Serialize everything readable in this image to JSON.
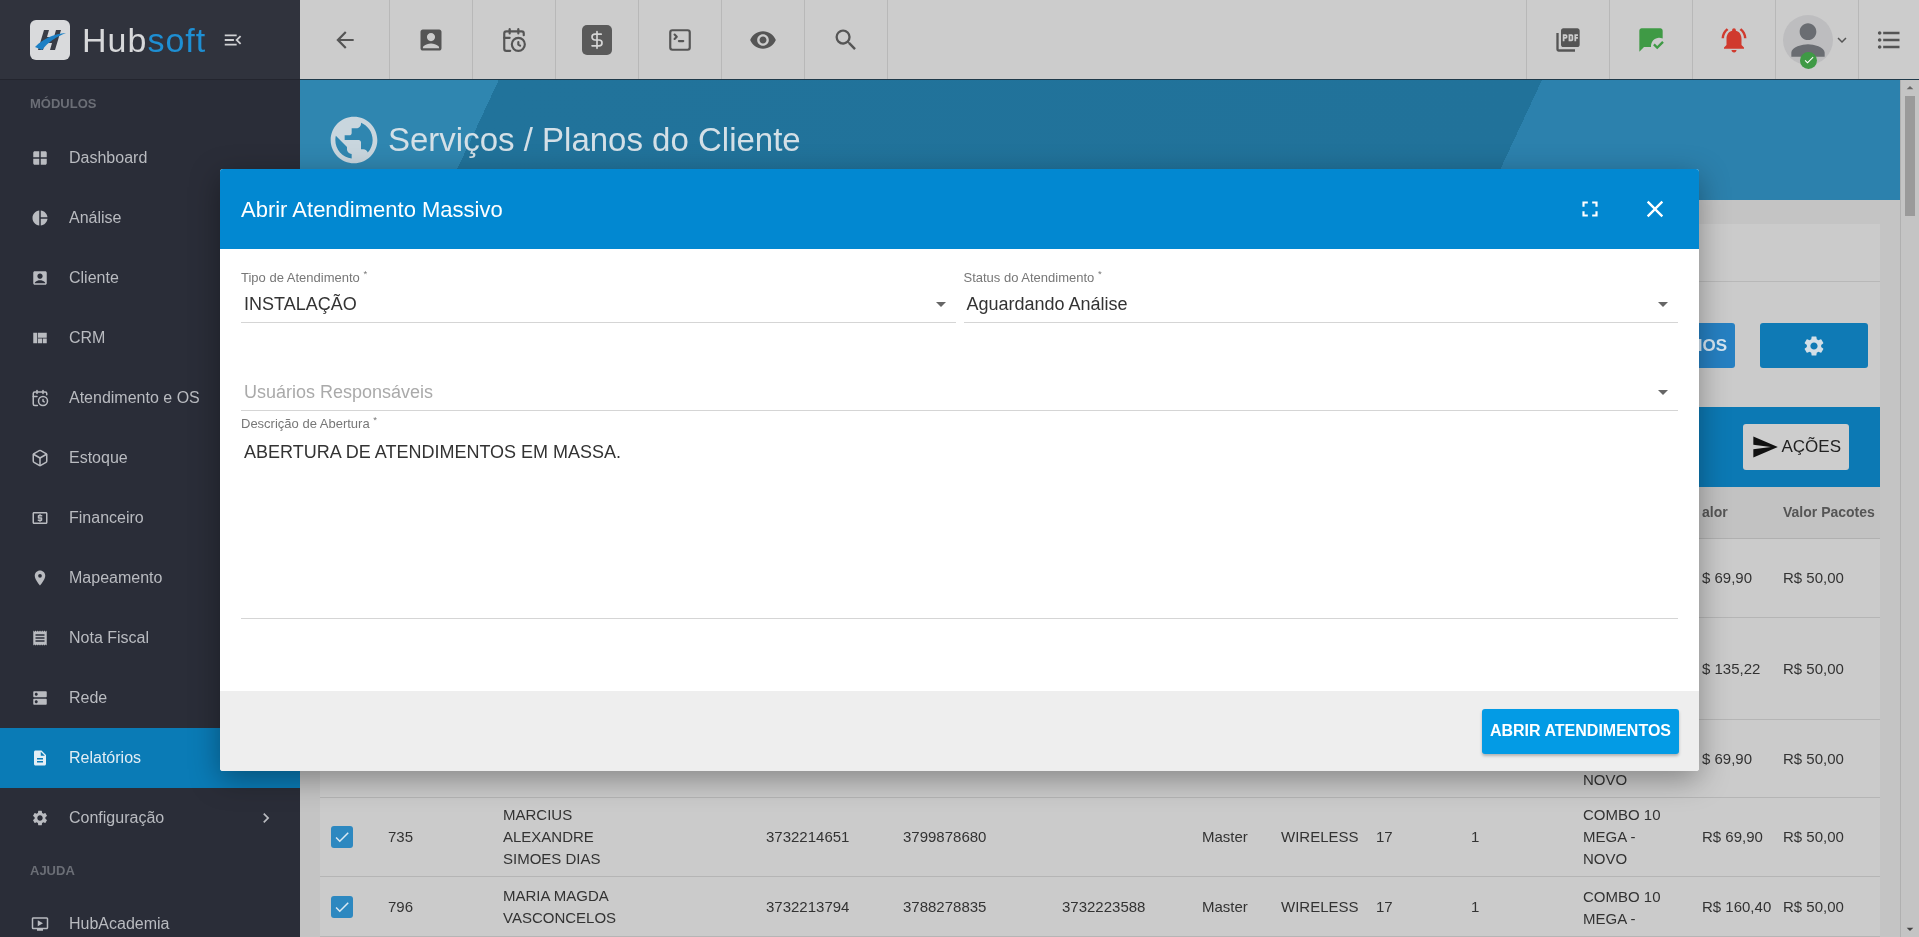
{
  "sidebar": {
    "logo": {
      "text_main": "Hub",
      "text_accent": "soft"
    },
    "sections": [
      {
        "heading": "MÓDULOS",
        "items": [
          {
            "label": "Dashboard",
            "selected": false,
            "has_submenu": false
          },
          {
            "label": "Análise",
            "selected": false,
            "has_submenu": false
          },
          {
            "label": "Cliente",
            "selected": false,
            "has_submenu": false
          },
          {
            "label": "CRM",
            "selected": false,
            "has_submenu": false
          },
          {
            "label": "Atendimento e OS",
            "selected": false,
            "has_submenu": false
          },
          {
            "label": "Estoque",
            "selected": false,
            "has_submenu": false
          },
          {
            "label": "Financeiro",
            "selected": false,
            "has_submenu": false
          },
          {
            "label": "Mapeamento",
            "selected": false,
            "has_submenu": false
          },
          {
            "label": "Nota Fiscal",
            "selected": false,
            "has_submenu": false
          },
          {
            "label": "Rede",
            "selected": false,
            "has_submenu": false
          },
          {
            "label": "Relatórios",
            "selected": true,
            "has_submenu": false
          },
          {
            "label": "Configuração",
            "selected": false,
            "has_submenu": true
          }
        ]
      },
      {
        "heading": "AJUDA",
        "items": [
          {
            "label": "HubAcademia",
            "selected": false,
            "has_submenu": false
          }
        ]
      }
    ]
  },
  "page": {
    "title": "Serviços / Planos do Cliente",
    "toolbar_button": "IOS",
    "actions_button": "AÇÕES"
  },
  "table": {
    "columns": [
      "alor",
      "Valor Pacotes"
    ],
    "rows": [
      {
        "value": "$ 69,90",
        "package_value": "R$ 50,00"
      },
      {
        "value": "$ 135,22",
        "package_value": "R$ 50,00"
      },
      {
        "plan": "NOVO",
        "value": "$ 69,90",
        "package_value": "R$ 50,00"
      },
      {
        "checked": true,
        "id": "735",
        "name": "MARCIUS ALEXANDRE SIMOES DIAS",
        "phone_1": "3732214651",
        "phone_2": "3799878680",
        "column_7": "Master",
        "column_8": "WIRELESS",
        "column_9": "17",
        "column_10": "1",
        "plan": "COMBO 10 MEGA - NOVO",
        "value": "R$ 69,90",
        "package_value": "R$ 50,00"
      },
      {
        "checked": true,
        "id": "796",
        "name": "MARIA MAGDA VASCONCELOS",
        "phone_1": "3732213794",
        "phone_2": "3788278835",
        "phone_3": "3732223588",
        "column_7": "Master",
        "column_8": "WIRELESS",
        "column_9": "17",
        "column_10": "1",
        "plan": "COMBO 10 MEGA -",
        "value": "R$ 160,40",
        "package_value": "R$ 50,00"
      }
    ]
  },
  "modal": {
    "title": "Abrir Atendimento Massivo",
    "fields": [
      {
        "kind": "select",
        "label": "Tipo de Atendimento $^{*}$",
        "value": "INSTALAÇÃO"
      },
      {
        "kind": "select",
        "label": "Status do Atendimento $^{*}$",
        "value": "Aguardando Análise"
      },
      {
        "kind": "select",
        "placeholder": "Usuários Responsáveis"
      },
      {
        "kind": "textarea",
        "label": "Descrição de Abertura $^{*}$",
        "value": "ABERTURA DE ATENDIMENTOS EM MASSA."
      }
    ],
    "submit_button": "ABRIR ATENDIMENTOS"
  }
}
